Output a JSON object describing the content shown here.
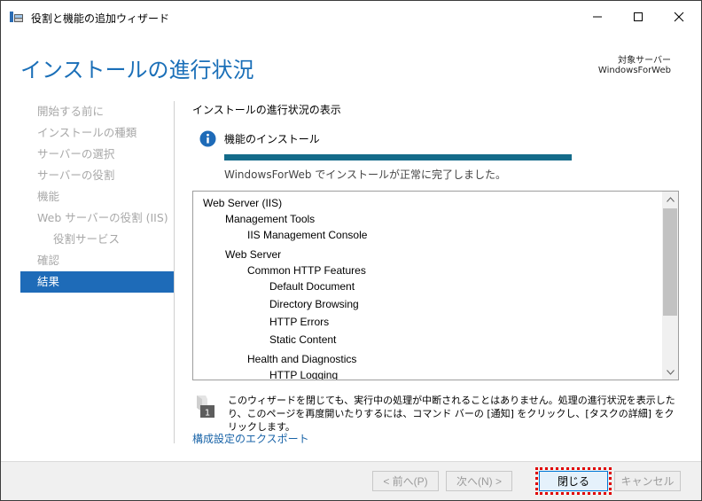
{
  "window": {
    "title": "役割と機能の追加ウィザード"
  },
  "header": {
    "page_title": "インストールの進行状況",
    "target_label": "対象サーバー",
    "target_value": "WindowsForWeb"
  },
  "nav": {
    "items": [
      {
        "label": "開始する前に",
        "state": "disabled"
      },
      {
        "label": "インストールの種類",
        "state": "disabled"
      },
      {
        "label": "サーバーの選択",
        "state": "disabled"
      },
      {
        "label": "サーバーの役割",
        "state": "disabled"
      },
      {
        "label": "機能",
        "state": "disabled"
      },
      {
        "label": "Web サーバーの役割 (IIS)",
        "state": "disabled"
      },
      {
        "label": "役割サービス",
        "state": "disabled"
      },
      {
        "label": "確認",
        "state": "disabled"
      },
      {
        "label": "結果",
        "state": "active"
      }
    ]
  },
  "main": {
    "section_title": "インストールの進行状況の表示",
    "feature_label": "機能のインストール",
    "progress": 1.0,
    "status_text": "WindowsForWeb でインストールが正常に完了しました。",
    "tree": [
      {
        "label": "Web Server (IIS)",
        "level": 0
      },
      {
        "label": "Management Tools",
        "level": 1
      },
      {
        "label": "IIS Management Console",
        "level": 2
      },
      {
        "label": "Web Server",
        "level": 1
      },
      {
        "label": "Common HTTP Features",
        "level": 2
      },
      {
        "label": "Default Document",
        "level": 3
      },
      {
        "label": "Directory Browsing",
        "level": 3
      },
      {
        "label": "HTTP Errors",
        "level": 3
      },
      {
        "label": "Static Content",
        "level": 3
      },
      {
        "label": "Health and Diagnostics",
        "level": 2
      },
      {
        "label": "HTTP Logging",
        "level": 3
      }
    ],
    "note_badge": "1",
    "note_text": "このウィザードを閉じても、実行中の処理が中断されることはありません。処理の進行状況を表示したり、このページを再度開いたりするには、コマンド バーの [通知] をクリックし、[タスクの詳細] をクリックします。",
    "export_link": "構成設定のエクスポート"
  },
  "footer": {
    "prev_label": "< 前へ(P)",
    "next_label": "次へ(N) >",
    "close_label": "閉じる",
    "cancel_label": "キャンセル"
  },
  "colors": {
    "accent": "#1e6bb8",
    "title_blue": "#1a6fb8",
    "progress": "#146b8a",
    "focus_ring": "#e00000"
  },
  "icons": {
    "app": "server-manager-icon",
    "info": "info-icon",
    "note": "flag-icon"
  }
}
